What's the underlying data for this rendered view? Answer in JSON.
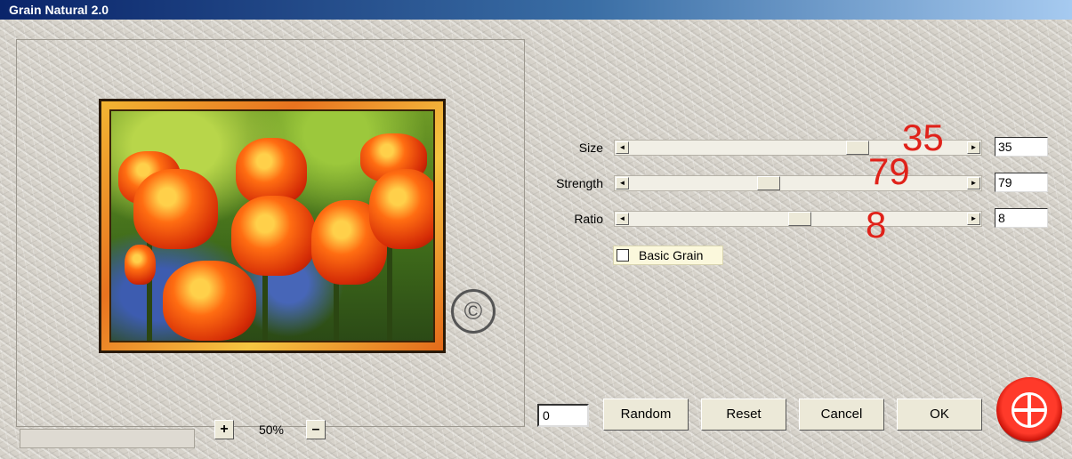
{
  "window": {
    "title": "Grain Natural 2.0"
  },
  "zoom": {
    "plus_label": "+",
    "value": "50%",
    "minus_label": "–"
  },
  "params": [
    {
      "label": "Size",
      "value": "35",
      "annotation": "35",
      "level_fraction": 0.62
    },
    {
      "label": "Strength",
      "value": "79",
      "annotation": "79",
      "level_fraction": 0.4
    },
    {
      "label": "Ratio",
      "value": "8",
      "annotation": "8",
      "level_fraction": 0.51
    }
  ],
  "checkbox": {
    "label": "Basic Grain",
    "checked": false
  },
  "seed": {
    "value": "0"
  },
  "buttons": {
    "random": "Random",
    "reset": "Reset",
    "cancel": "Cancel",
    "ok": "OK"
  },
  "watermark": {
    "symbol": "©"
  },
  "arrows": {
    "left": "◄",
    "right": "►"
  },
  "colors": {
    "annotation": "#e0221a",
    "title_start": "#0a246a",
    "title_end": "#a6caf0"
  }
}
